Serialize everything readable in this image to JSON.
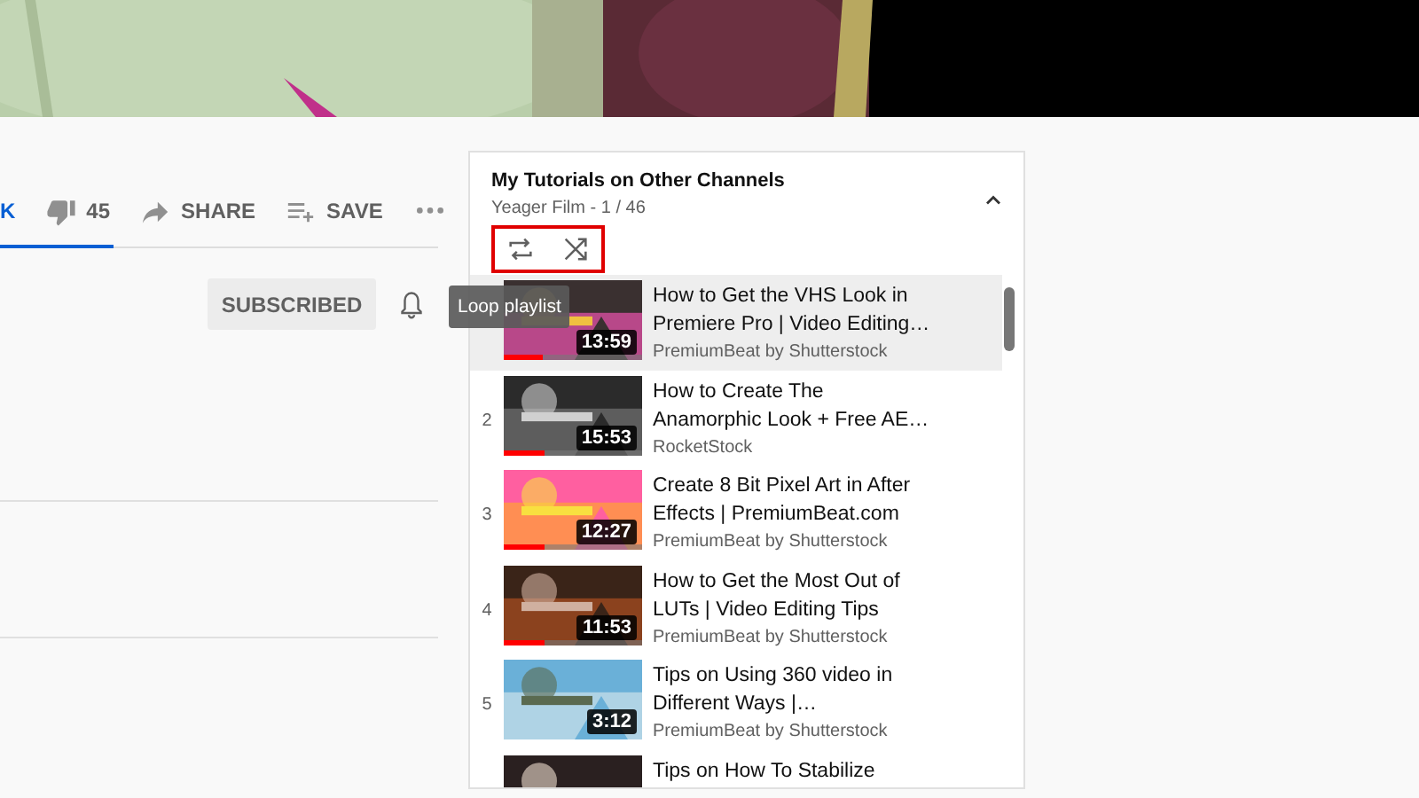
{
  "actions": [
    {
      "kind": "like",
      "label": "K",
      "selected": true
    },
    {
      "kind": "dislike",
      "label": "45",
      "selected": false
    },
    {
      "kind": "share",
      "label": "SHARE"
    },
    {
      "kind": "save",
      "label": "SAVE"
    },
    {
      "kind": "more"
    }
  ],
  "subscribe_button": {
    "label": "SUBSCRIBED",
    "subscribed": true
  },
  "notification_bell": {
    "kind": "bell"
  },
  "playlist": {
    "title": "My Tutorials on Other Channels",
    "subtitle": "Yeager Film - 1 / 46",
    "expanded": true,
    "controls_highlighted": true,
    "controls": [
      {
        "kind": "loop"
      },
      {
        "kind": "shuffle"
      }
    ],
    "tooltip": "Loop playlist",
    "items": [
      {
        "title_lines": [
          "How to Get the VHS Look in",
          "Premiere Pro | Video Editing…"
        ],
        "channel": "PremiumBeat by Shutterstock",
        "duration": "13:59",
        "selected": true,
        "level": 0.28
      },
      {
        "index": "2",
        "title_lines": [
          "How to Create The",
          "Anamorphic Look + Free AE…"
        ],
        "channel": "RocketStock",
        "duration": "15:53",
        "selected": false,
        "level": 0.3
      },
      {
        "index": "3",
        "title_lines": [
          "Create 8 Bit Pixel Art in After",
          "Effects | PremiumBeat.com"
        ],
        "channel": "PremiumBeat by Shutterstock",
        "duration": "12:27",
        "selected": false,
        "level": 0.3
      },
      {
        "index": "4",
        "title_lines": [
          "How to Get the Most Out of",
          "LUTs | Video Editing Tips"
        ],
        "channel": "PremiumBeat by Shutterstock",
        "duration": "11:53",
        "selected": false,
        "level": 0.3
      },
      {
        "index": "5",
        "title_lines": [
          "Tips on Using 360 video in",
          "Different Ways |…"
        ],
        "channel": "PremiumBeat by Shutterstock",
        "duration": "3:12",
        "selected": false
      },
      {
        "title_lines": [
          "Tips on How To Stabilize"
        ],
        "selected": false
      }
    ]
  }
}
